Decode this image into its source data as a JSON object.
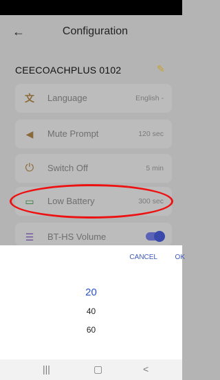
{
  "app_bar": {
    "title": "Configuration",
    "back_icon": "arrow-left-icon"
  },
  "device": {
    "name": "CEECOACHPLUS 0102",
    "edit_icon": "pencil-icon"
  },
  "settings": [
    {
      "label": "Language",
      "value": "English -",
      "icon": "translate-icon"
    },
    {
      "label": "Mute Prompt",
      "value": "120 sec",
      "icon": "mute-icon"
    },
    {
      "label": "Switch Off",
      "value": "5 min",
      "icon": "power-icon"
    },
    {
      "label": "Low Battery",
      "value": "300 sec",
      "icon": "battery-icon"
    },
    {
      "label": "BT-HS Volume",
      "value": "",
      "icon": "equalizer-icon"
    }
  ],
  "bt_hs_volume_enabled": true,
  "picker": {
    "cancel_label": "CANCEL",
    "ok_label": "OK",
    "options": [
      "20",
      "40",
      "60"
    ],
    "selected": "20"
  },
  "nav": {
    "recents": "|||",
    "home": "▢",
    "back": "<"
  },
  "colors": {
    "accent": "#3a55c0",
    "highlight": "#e11111",
    "toggle": "#3949ab"
  }
}
